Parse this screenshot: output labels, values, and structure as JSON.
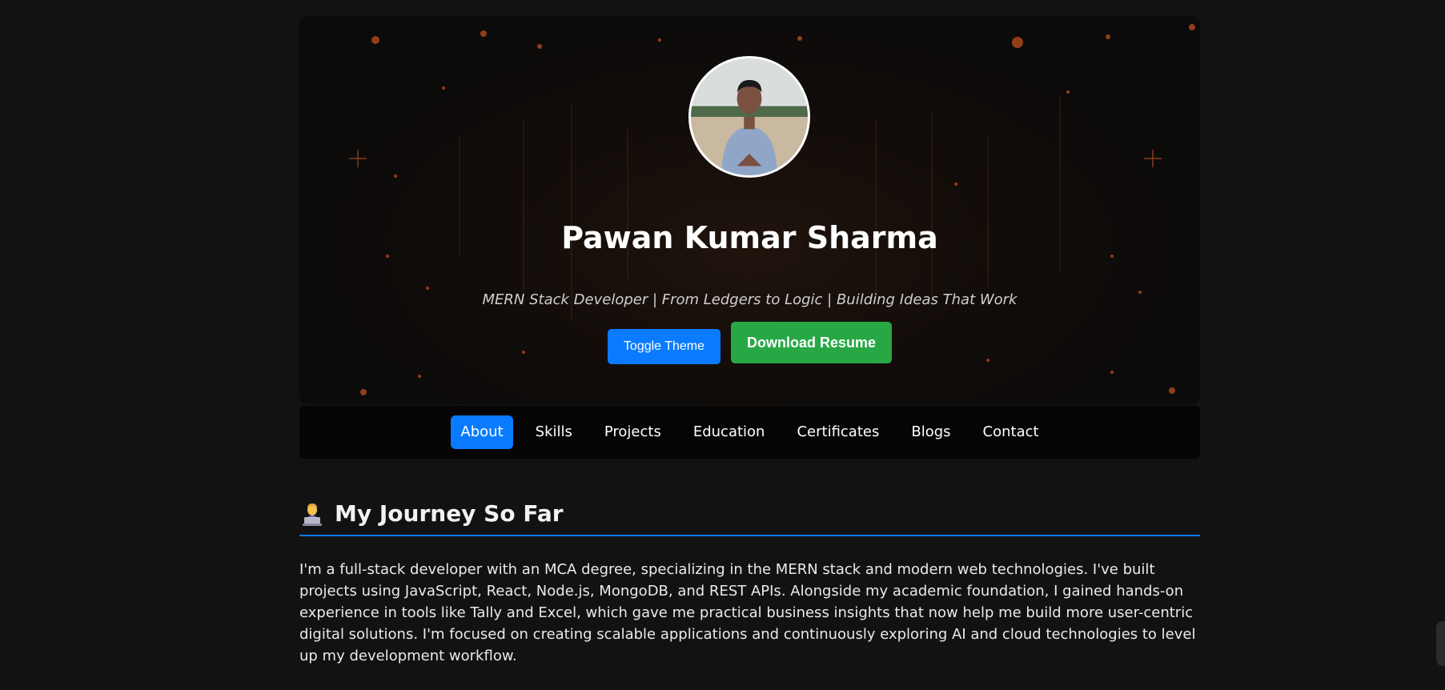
{
  "hero": {
    "name": "Pawan Kumar Sharma",
    "tagline": "MERN Stack Developer | From Ledgers to Logic | Building Ideas That Work",
    "avatar_icon": "profile-photo",
    "buttons": {
      "toggle_theme": "Toggle Theme",
      "download_resume": "Download Resume"
    }
  },
  "nav": {
    "items": [
      {
        "label": "About",
        "active": true
      },
      {
        "label": "Skills",
        "active": false
      },
      {
        "label": "Projects",
        "active": false
      },
      {
        "label": "Education",
        "active": false
      },
      {
        "label": "Certificates",
        "active": false
      },
      {
        "label": "Blogs",
        "active": false
      },
      {
        "label": "Contact",
        "active": false
      }
    ]
  },
  "about": {
    "icon": "technologist-emoji-icon",
    "title": "My Journey So Far",
    "body": "I'm a full-stack developer with an MCA degree, specializing in the MERN stack and modern web technologies. I've built projects using JavaScript, React, Node.js, MongoDB, and REST APIs. Alongside my academic foundation, I gained hands-on experience in tools like Tally and Excel, which gave me practical business insights that now help me build more user-centric digital solutions. I'm focused on creating scalable applications and continuously exploring AI and cloud technologies to level up my development workflow."
  },
  "colors": {
    "background": "#121212",
    "accent": "#0a7bff",
    "resume_button": "#28a745",
    "nav_bg": "#050505"
  }
}
